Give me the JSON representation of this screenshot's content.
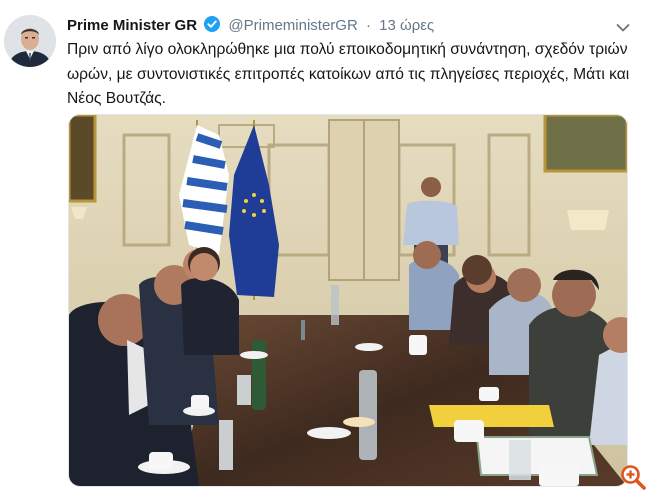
{
  "tweet": {
    "author_name": "Prime Minister GR",
    "author_handle": "@PrimeministerGR",
    "separator": "·",
    "time": "13 ώρες",
    "text": "Πριν από λίγο ολοκληρώθηκε μια πολύ εποικοδομητική συνάντηση, σχεδόν τριών ωρών, με συντονιστικές επιτροπές κατοίκων από τις πληγείσες περιοχές, Μάτι και Νέος Βουτζάς."
  },
  "icons": {
    "verified": "verified-badge-icon",
    "caret": "chevron-down-icon",
    "zoom": "zoom-in-icon"
  },
  "colors": {
    "verified_blue": "#1da1f2",
    "secondary_text": "#657786",
    "zoom_orange": "#e0541f"
  }
}
